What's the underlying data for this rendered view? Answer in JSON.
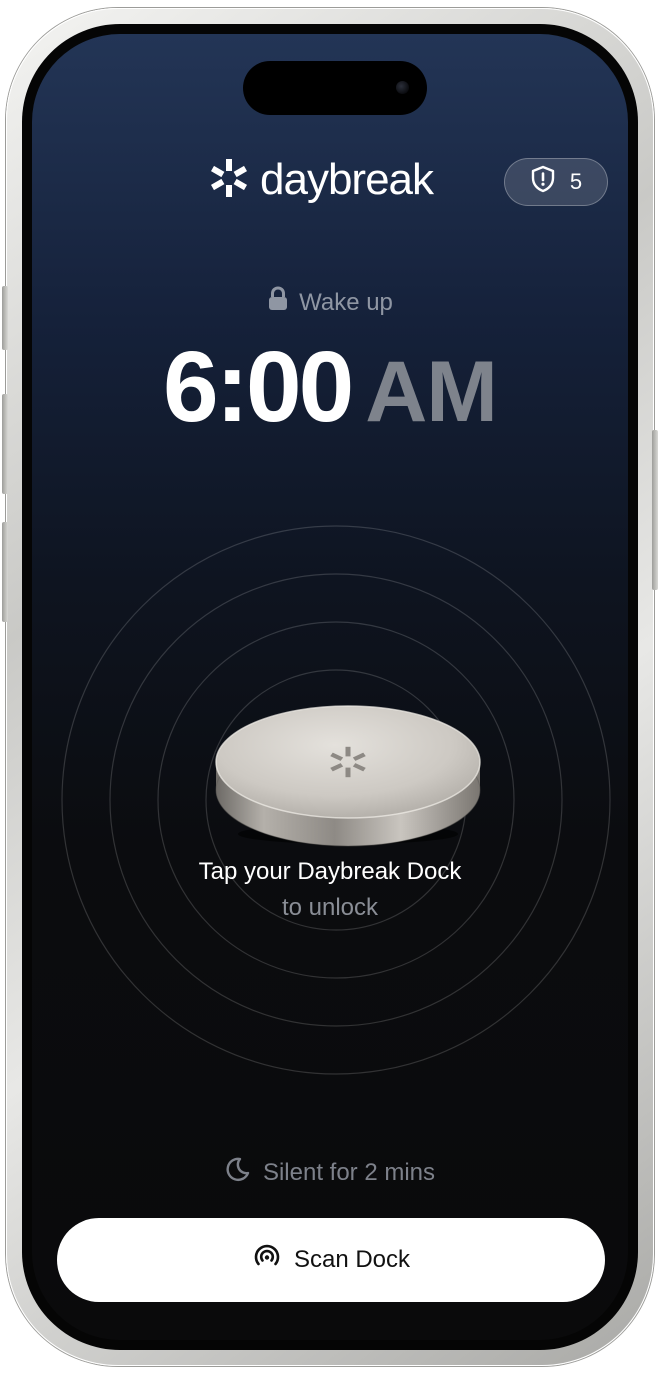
{
  "header": {
    "brand_name": "daybreak",
    "logo_icon": "daybreak-burst-icon",
    "badge": {
      "icon": "shield-alert-icon",
      "count": "5"
    }
  },
  "alarm": {
    "label_icon": "lock-icon",
    "label": "Wake up",
    "time": "6:00",
    "period": "AM"
  },
  "dock": {
    "image": "daybreak-dock-puck",
    "instruction_line1": "Tap your Daybreak Dock",
    "instruction_line2": "to unlock"
  },
  "status": {
    "icon": "moon-icon",
    "text": "Silent for 2 mins"
  },
  "actions": {
    "scan_icon": "nfc-signal-icon",
    "scan_label": "Scan Dock"
  },
  "colors": {
    "background_top": "#233556",
    "background_bottom": "#0a0a0b",
    "text_primary": "#ffffff",
    "text_muted": "#7e838c",
    "button_bg": "#ffffff"
  }
}
